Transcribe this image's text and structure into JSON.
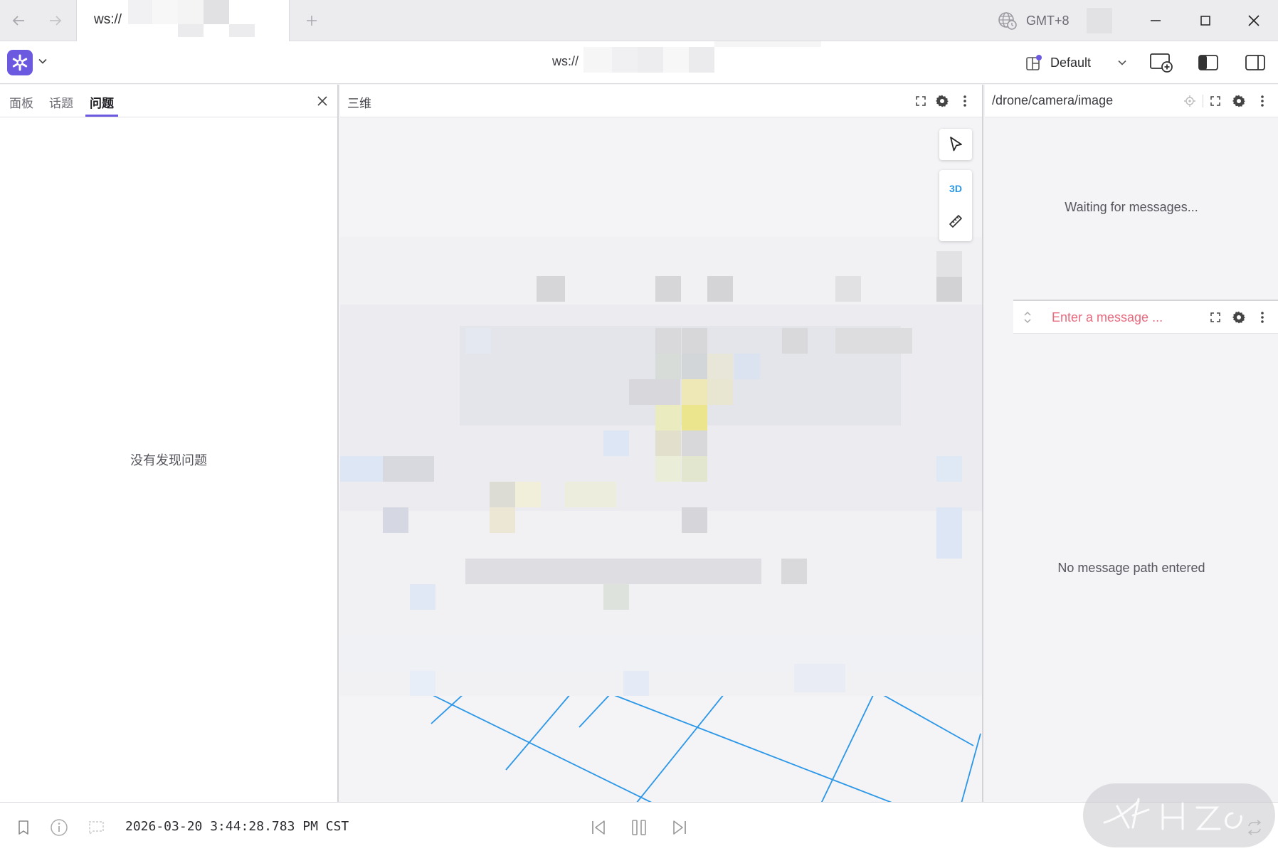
{
  "titlebar": {
    "back_icon": "arrow-left-icon",
    "forward_icon": "arrow-right-icon",
    "tab_label": "ws://",
    "new_tab_icon": "plus-icon",
    "timezone_icon": "globe-clock-icon",
    "timezone": "GMT+8",
    "window_controls": [
      "minimize-icon",
      "maximize-icon",
      "close-icon"
    ]
  },
  "toolbar": {
    "app_icon": "foxglove-logo-icon",
    "connection_url": "ws://",
    "layout_name": "Default",
    "layout_icon": "layout-icon",
    "add_panel_icon": "add-panel-icon",
    "left_sidebar_icon": "left-sidebar-toggle-icon",
    "right_sidebar_icon": "right-sidebar-toggle-icon"
  },
  "sidebar": {
    "tabs": [
      {
        "label": "面板",
        "active": false
      },
      {
        "label": "话题",
        "active": false
      },
      {
        "label": "问题",
        "active": true
      }
    ],
    "empty_message": "没有发现问题",
    "accent_color": "#6b5ae0"
  },
  "panel_3d": {
    "title": "三维",
    "tool_3d_label": "3D",
    "grid_color": "#2a97e8"
  },
  "panel_image": {
    "topic": "/drone/camera/image",
    "status": "Waiting for messages..."
  },
  "panel_raw": {
    "placeholder": "Enter a message ...",
    "status": "No message path entered"
  },
  "playback": {
    "timestamp": "2026-03-20 3:44:28.783 PM CST",
    "controls": [
      "seek-backward-icon",
      "pause-icon",
      "seek-forward-icon"
    ]
  }
}
